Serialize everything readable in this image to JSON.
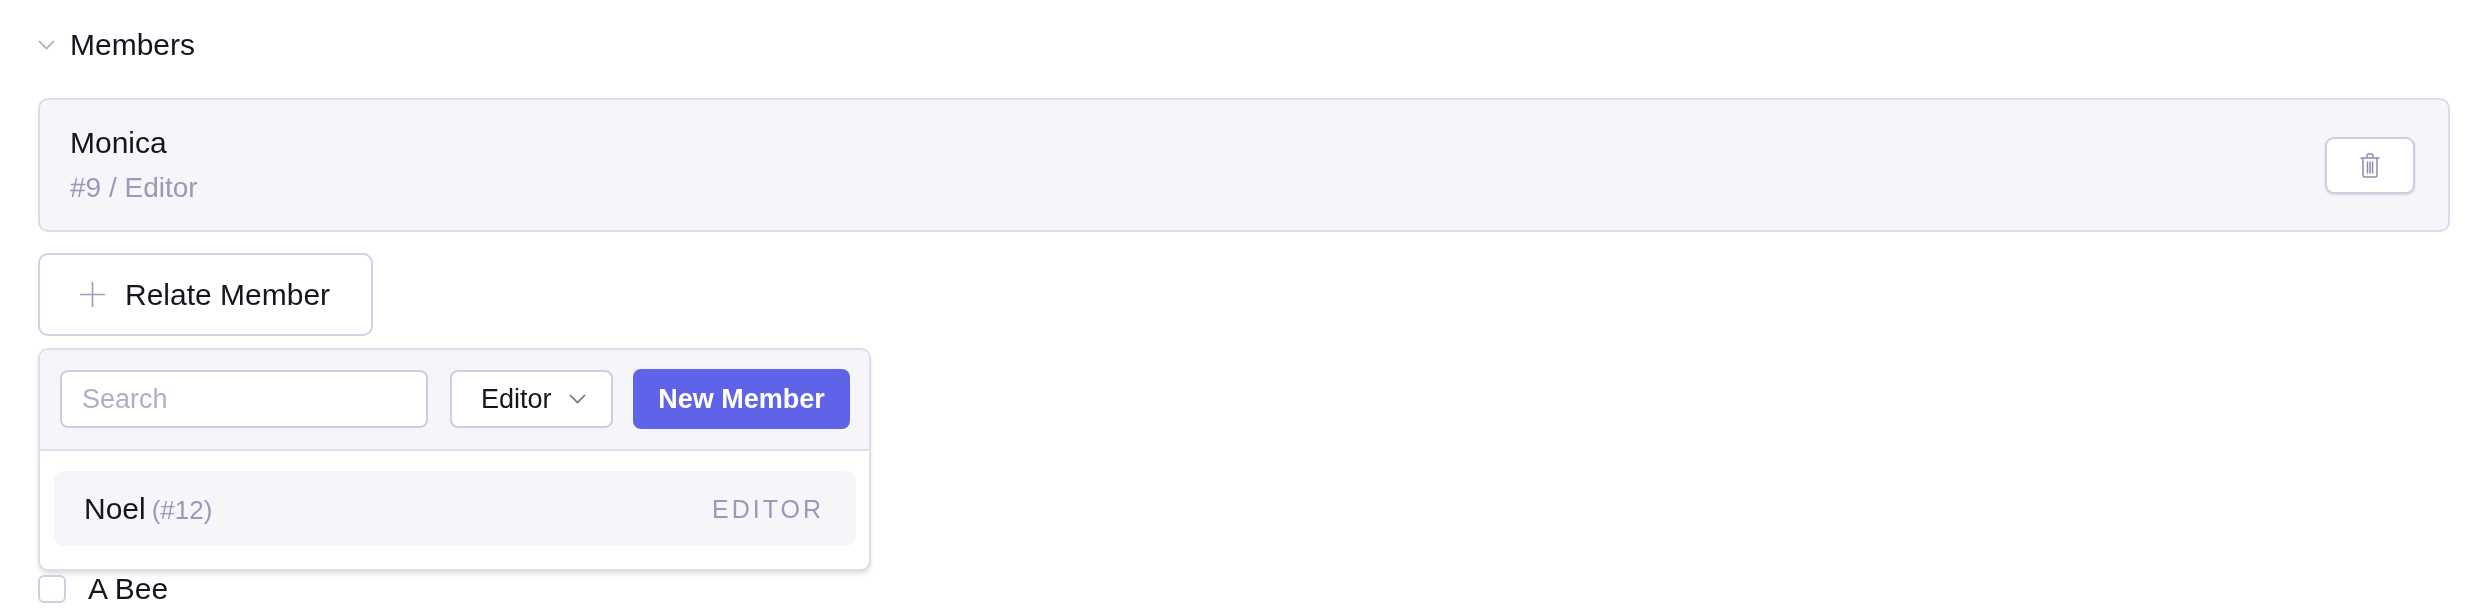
{
  "section": {
    "title": "Members",
    "expanded": true
  },
  "members": [
    {
      "name": "Monica",
      "subtitle": "#9 / Editor"
    }
  ],
  "relate_button": {
    "label": "Relate Member"
  },
  "popover": {
    "search": {
      "placeholder": "Search"
    },
    "role_select": {
      "value": "Editor"
    },
    "new_button": {
      "label": "New Member"
    },
    "results": [
      {
        "name": "Noel",
        "id": "(#12)",
        "role": "EDITOR"
      }
    ]
  },
  "options": [
    {
      "label": "A Bee",
      "checked": false
    }
  ]
}
